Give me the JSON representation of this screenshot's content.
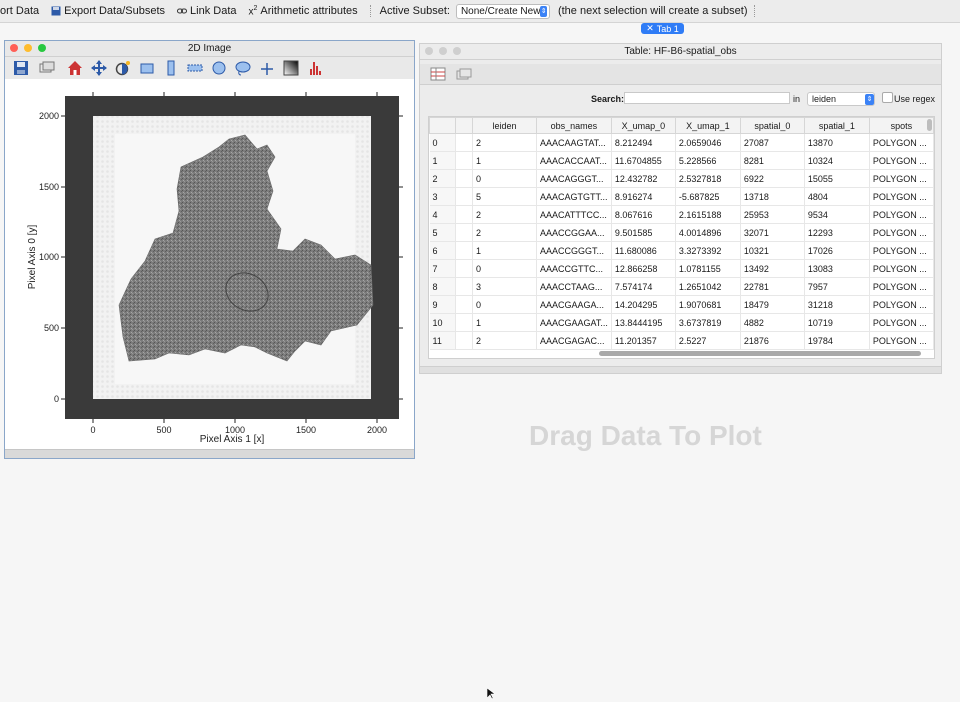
{
  "toolbar": {
    "export_data": "ort Data",
    "export_subsets": "Export Data/Subsets",
    "link_data": "Link Data",
    "arithmetic": "Arithmetic attributes",
    "active_subset_label": "Active Subset:",
    "active_subset_value": "None/Create New",
    "subset_hint": "(the next selection will create a subset)"
  },
  "tab": {
    "label": "Tab 1"
  },
  "image_window": {
    "title": "2D Image",
    "x_axis_label": "Pixel Axis 1 [x]",
    "y_axis_label": "Pixel Axis 0 [y]",
    "x_ticks": [
      "0",
      "500",
      "1000",
      "1500",
      "2000"
    ],
    "y_ticks": [
      "0",
      "500",
      "1000",
      "1500",
      "2000"
    ]
  },
  "table_window": {
    "title": "Table: HF-B6-spatial_obs",
    "search_label": "Search:",
    "search_value": "",
    "in_label": "in",
    "in_value": "leiden",
    "regex_label": "Use regex",
    "columns": [
      "leiden",
      "obs_names",
      "X_umap_0",
      "X_umap_1",
      "spatial_0",
      "spatial_1",
      "spots"
    ],
    "rows": [
      [
        "0",
        "2",
        "AAACAAGTAT...",
        "8.212494",
        "2.0659046",
        "27087",
        "13870",
        "POLYGON ..."
      ],
      [
        "1",
        "1",
        "AAACACCAAT...",
        "11.6704855",
        "5.228566",
        "8281",
        "10324",
        "POLYGON ..."
      ],
      [
        "2",
        "0",
        "AAACAGGGT...",
        "12.432782",
        "2.5327818",
        "6922",
        "15055",
        "POLYGON ..."
      ],
      [
        "3",
        "5",
        "AAACAGTGTT...",
        "8.916274",
        "-5.687825",
        "13718",
        "4804",
        "POLYGON ..."
      ],
      [
        "4",
        "2",
        "AAACATTTCC...",
        "8.067616",
        "2.1615188",
        "25953",
        "9534",
        "POLYGON ..."
      ],
      [
        "5",
        "2",
        "AAACCGGAA...",
        "9.501585",
        "4.0014896",
        "32071",
        "12293",
        "POLYGON ..."
      ],
      [
        "6",
        "1",
        "AAACCGGGT...",
        "11.680086",
        "3.3273392",
        "10321",
        "17026",
        "POLYGON ..."
      ],
      [
        "7",
        "0",
        "AAACCGTTC...",
        "12.866258",
        "1.0781155",
        "13492",
        "13083",
        "POLYGON ..."
      ],
      [
        "8",
        "3",
        "AAACCTAAG...",
        "7.574174",
        "1.2651042",
        "22781",
        "7957",
        "POLYGON ..."
      ],
      [
        "9",
        "0",
        "AAACGAAGA...",
        "14.204295",
        "1.9070681",
        "18479",
        "31218",
        "POLYGON ..."
      ],
      [
        "10",
        "1",
        "AAACGAAGAT...",
        "13.8444195",
        "3.6737819",
        "4882",
        "10719",
        "POLYGON ..."
      ],
      [
        "11",
        "2",
        "AAACGAGAC...",
        "11.201357",
        "2.5227",
        "21876",
        "19784",
        "POLYGON ..."
      ]
    ]
  },
  "placeholder": {
    "drag_text": "Drag Data To Plot"
  },
  "colors": {
    "accent": "#2f7cf6",
    "close": "#ff5f57",
    "minimize": "#febc2e",
    "maximize": "#28c840"
  }
}
